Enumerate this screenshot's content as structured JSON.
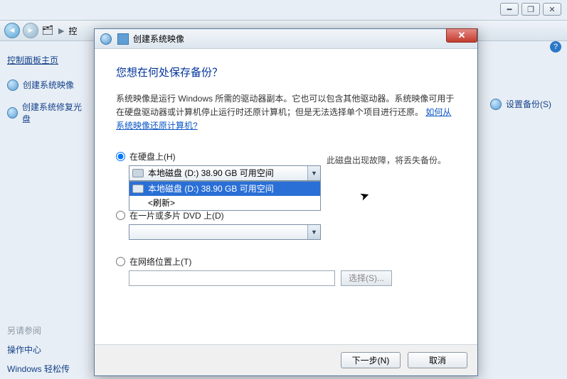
{
  "window_controls": {
    "min": "━",
    "max": "❐",
    "close": "✕"
  },
  "navbar": {
    "back": "◄",
    "fwd": "►",
    "crumb_sep": "▶",
    "crumb_text": "控"
  },
  "sidebar": {
    "home": "控制面板主页",
    "links": [
      {
        "label": "创建系统映像"
      },
      {
        "label": "创建系统修复光盘"
      }
    ],
    "bottom": {
      "see_also": "另请参阅",
      "action_center": "操作中心",
      "easy_transfer": "Windows 轻松传"
    }
  },
  "right_task": {
    "label": "设置备份(S)"
  },
  "wizard": {
    "title": "创建系统映像",
    "close": "✕",
    "heading": "您想在何处保存备份？",
    "desc_pre": "系统映像是运行 Windows 所需的驱动器副本。它也可以包含其他驱动器。系统映像可用于在硬盘驱动器或计算机停止运行时还原计算机；但是无法选择单个项目进行还原。",
    "desc_link": "如何从系统映像还原计算机?",
    "options": {
      "hdd": {
        "label": "在硬盘上(H)"
      },
      "combo_selected": "本地磁盘 (D:) 38.90 GB 可用空间",
      "dropdown": {
        "item_selected": "本地磁盘 (D:) 38.90 GB 可用空间",
        "refresh": "<刷新>"
      },
      "warning": "此磁盘出现故障，将丢失备份。",
      "dvd": {
        "label": "在一片或多片 DVD 上(D)"
      },
      "net": {
        "label": "在网络位置上(T)"
      },
      "select_btn": "选择(S)..."
    },
    "footer": {
      "next": "下一步(N)",
      "cancel": "取消"
    }
  }
}
